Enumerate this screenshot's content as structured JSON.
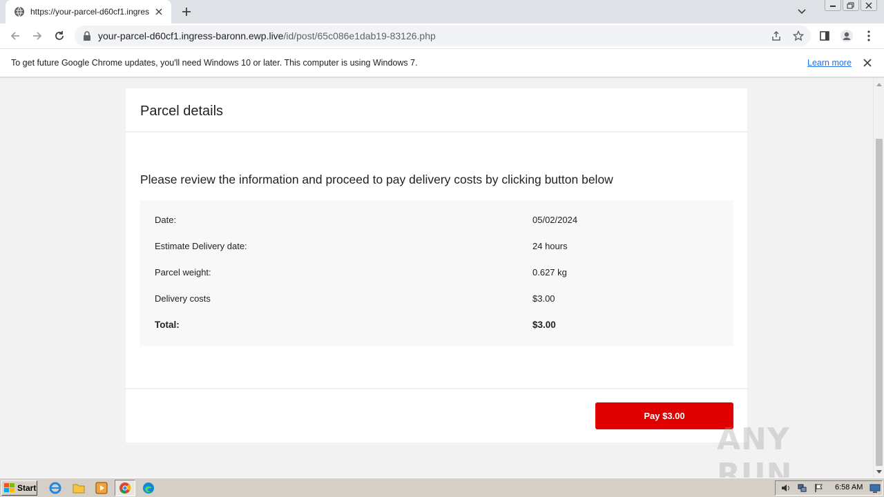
{
  "browser": {
    "tab_title": "https://your-parcel-d60cf1.ingress-b",
    "url_host": "your-parcel-d60cf1.ingress-baronn.ewp.live",
    "url_path": "/id/post/65c086e1dab19-83126.php"
  },
  "infobar": {
    "message": "To get future Google Chrome updates, you'll need Windows 10 or later. This computer is using Windows 7.",
    "learn_more": "Learn more"
  },
  "page": {
    "heading": "Parcel details",
    "lead": "Please review the information and proceed to pay delivery costs by clicking button below",
    "details": [
      {
        "label": "Date:",
        "value": "05/02/2024"
      },
      {
        "label": "Estimate Delivery date:",
        "value": "24 hours"
      },
      {
        "label": "Parcel weight:",
        "value": "0.627 kg"
      },
      {
        "label": "Delivery costs",
        "value": "$3.00"
      },
      {
        "label": "Total:",
        "value": "$3.00"
      }
    ],
    "pay_button": "Pay $3.00",
    "accent_color": "#e00000"
  },
  "watermark": "ANY RUN",
  "taskbar": {
    "start_label": "Start",
    "clock": "6:58 AM"
  }
}
